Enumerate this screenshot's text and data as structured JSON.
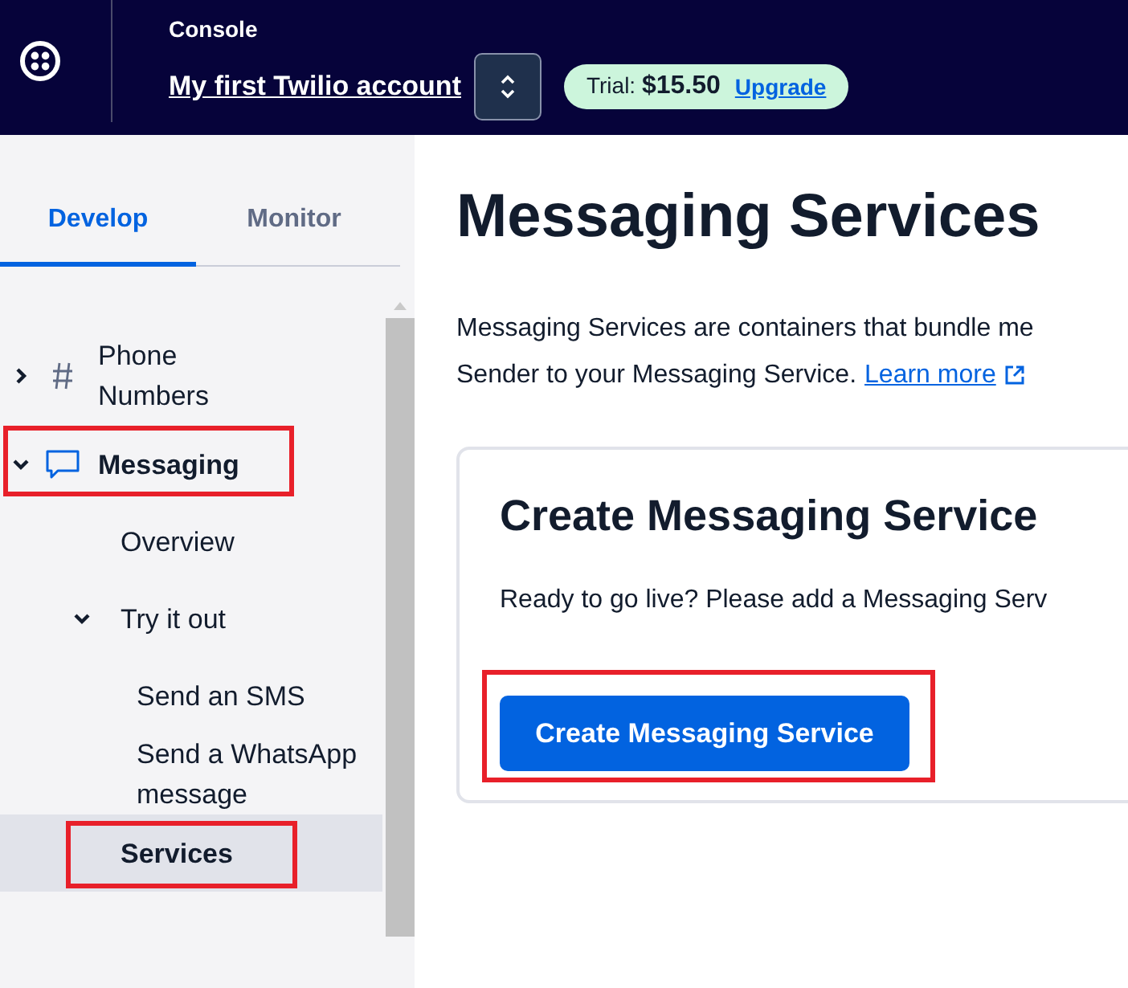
{
  "header": {
    "section": "Console",
    "account": "My first Twilio account",
    "trial": "Trial: **$15.50**",
    "upgrade": "Upgrade"
  },
  "tabs": [
    {
      "label": "Develop",
      "selected": true
    },
    {
      "label": "Monitor",
      "selected": false
    }
  ],
  "nav": [
    {
      "label": "Phone Numbers",
      "expanded": false,
      "selected": false,
      "highlighted": false
    },
    {
      "label": "Messaging",
      "expanded": true,
      "selected": false,
      "highlighted": true,
      "children": [
        {
          "label": "Overview",
          "selected": false,
          "highlighted": false
        },
        {
          "label": "Try it out",
          "expanded": true,
          "selected": false,
          "highlighted": false,
          "children": [
            {
              "label": "Send an SMS",
              "selected": false,
              "highlighted": false
            },
            {
              "label": "Send a WhatsApp message",
              "selected": false,
              "highlighted": false
            }
          ]
        },
        {
          "label": "Services",
          "selected": true,
          "highlighted": true
        }
      ]
    }
  ],
  "page": {
    "title": "Messaging Services",
    "intro_lines": [
      "Messaging Services are containers that bundle me",
      "Sender to your Messaging Service."
    ],
    "learn_more": "Learn more",
    "card": {
      "title": "Create Messaging Service",
      "text": "Ready to go live? Please add a Messaging Serv",
      "button": "Create Messaging Service",
      "button_highlighted": true
    }
  }
}
